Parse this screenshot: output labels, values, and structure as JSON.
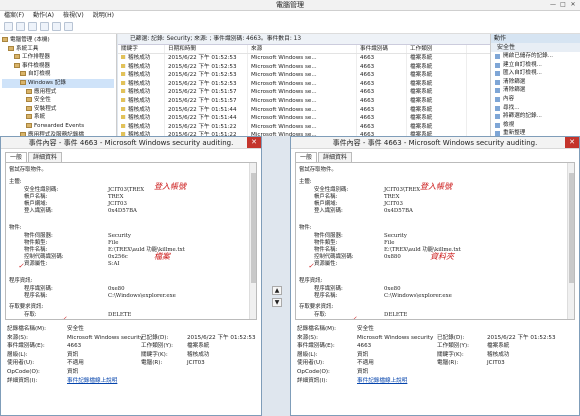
{
  "window": {
    "title": "電腦管理",
    "controls": [
      "—",
      "□",
      "✕"
    ]
  },
  "menu": [
    "檔案(F)",
    "動作(A)",
    "檢視(V)",
    "說明(H)"
  ],
  "tree": [
    {
      "label": "電腦管理 (本機)",
      "indent": 0
    },
    {
      "label": "系統工具",
      "indent": 1
    },
    {
      "label": "工作排程器",
      "indent": 2
    },
    {
      "label": "事件檢視器",
      "indent": 2
    },
    {
      "label": "自訂檢視",
      "indent": 3
    },
    {
      "label": "Windows 記錄",
      "indent": 3,
      "selected": true
    },
    {
      "label": "應用程式",
      "indent": 4
    },
    {
      "label": "安全性",
      "indent": 4
    },
    {
      "label": "安裝程式",
      "indent": 4
    },
    {
      "label": "系統",
      "indent": 4
    },
    {
      "label": "Forwarded Events",
      "indent": 4
    },
    {
      "label": "應用程式及服務記錄檔",
      "indent": 3
    }
  ],
  "list": {
    "header": "已篩選: 記錄: Security; 來源: ; 事件識別碼: 4663。事件數目: 13",
    "columns": [
      "關鍵字",
      "日期和時間",
      "來源",
      "事件識別碼",
      "工作類別"
    ],
    "rows": [
      [
        "稽核成功",
        "2015/6/22 下午 01:52:53",
        "Microsoft Windows se...",
        "4663",
        "檔案系統"
      ],
      [
        "稽核成功",
        "2015/6/22 下午 01:52:53",
        "Microsoft Windows se...",
        "4663",
        "檔案系統"
      ],
      [
        "稽核成功",
        "2015/6/22 下午 01:52:53",
        "Microsoft Windows se...",
        "4663",
        "檔案系統"
      ],
      [
        "稽核成功",
        "2015/6/22 下午 01:52:53",
        "Microsoft Windows se...",
        "4663",
        "檔案系統"
      ],
      [
        "稽核成功",
        "2015/6/22 下午 01:51:57",
        "Microsoft Windows se...",
        "4663",
        "檔案系統"
      ],
      [
        "稽核成功",
        "2015/6/22 下午 01:51:57",
        "Microsoft Windows se...",
        "4663",
        "檔案系統"
      ],
      [
        "稽核成功",
        "2015/6/22 下午 01:51:44",
        "Microsoft Windows se...",
        "4663",
        "檔案系統"
      ],
      [
        "稽核成功",
        "2015/6/22 下午 01:51:44",
        "Microsoft Windows se...",
        "4663",
        "檔案系統"
      ],
      [
        "稽核成功",
        "2015/6/22 下午 01:51:22",
        "Microsoft Windows se...",
        "4663",
        "檔案系統"
      ],
      [
        "稽核成功",
        "2015/6/22 下午 01:51:22",
        "Microsoft Windows se...",
        "4663",
        "檔案系統"
      ]
    ]
  },
  "actions": {
    "title": "動作",
    "section": "安全性",
    "items": [
      "開啟已儲存的記錄...",
      "建立自訂檢視...",
      "匯入自訂檢視...",
      "清除篩選",
      "清除篩選",
      "內容",
      "尋找...",
      "將篩選的記錄...",
      "檢視",
      "重新整理",
      "說明"
    ]
  },
  "dialogs": [
    {
      "title": "事件內容 - 事件 4663 - Microsoft Windows security auditing.",
      "tabs": [
        "一般",
        "詳細資料"
      ],
      "detail": {
        "heading": "嘗試存取物件。",
        "subject_label": "主體:",
        "fields1": [
          [
            "安全性識別碼:",
            "JCIT03\\TREX"
          ],
          [
            "帳戶名稱:",
            "TREX"
          ],
          [
            "帳戶網域:",
            "JCIT03"
          ],
          [
            "登入識別碼:",
            "0x4D57BA"
          ]
        ],
        "object_label": "物件:",
        "fields2": [
          [
            "物件伺服器:",
            "Security"
          ],
          [
            "物件類型:",
            "File"
          ],
          [
            "物件名稱:",
            "E:\\TREX\\auld 功能\\killme.txt"
          ],
          [
            "控制代碼識別碼:",
            "0x256c"
          ],
          [
            "資源屬性:",
            "S:AI"
          ]
        ],
        "process_label": "程序資訊:",
        "fields3": [
          [
            "程序識別碼:",
            "0xe80"
          ],
          [
            "程序名稱:",
            "C:\\Windows\\explorer.exe"
          ]
        ],
        "access_label": "存取要求資訊:",
        "fields4": [
          [
            "存取:",
            "DELETE"
          ]
        ],
        "notes": [
          "登入帳號",
          "檔案"
        ]
      },
      "meta": [
        [
          "記錄檔名稱(M):",
          "安全性",
          "",
          ""
        ],
        [
          "來源(S):",
          "Microsoft Windows security",
          "已記錄(D):",
          "2015/6/22 下午 01:52:53"
        ],
        [
          "事件識別碼(E):",
          "4663",
          "工作類別(Y):",
          "檔案系統"
        ],
        [
          "層級(L):",
          "資訊",
          "關鍵字(K):",
          "稽核成功"
        ],
        [
          "使用者(U):",
          "不適用",
          "電腦(R):",
          "JCIT03"
        ],
        [
          "OpCode(O):",
          "資訊",
          "",
          ""
        ],
        [
          "詳細資訊(I):",
          "事件記錄檔線上說明",
          "",
          ""
        ]
      ]
    },
    {
      "title": "事件內容 - 事件 4663 - Microsoft Windows security auditing.",
      "tabs": [
        "一般",
        "詳細資料"
      ],
      "detail": {
        "heading": "嘗試存取物件。",
        "subject_label": "主體:",
        "fields1": [
          [
            "安全性識別碼:",
            "JCIT03\\TREX"
          ],
          [
            "帳戶名稱:",
            "TREX"
          ],
          [
            "帳戶網域:",
            "JCIT03"
          ],
          [
            "登入識別碼:",
            "0x4D57BA"
          ]
        ],
        "object_label": "物件:",
        "fields2": [
          [
            "物件伺服器:",
            "Security"
          ],
          [
            "物件類型:",
            "File"
          ],
          [
            "物件名稱:",
            "E:\\TREX\\auld 功能\\killme.txt"
          ],
          [
            "控制代碼識別碼:",
            "0x880"
          ],
          [
            "資源屬性:",
            ""
          ]
        ],
        "process_label": "程序資訊:",
        "fields3": [
          [
            "程序識別碼:",
            "0xe80"
          ],
          [
            "程序名稱:",
            "C:\\Windows\\explorer.exe"
          ]
        ],
        "access_label": "存取要求資訊:",
        "fields4": [
          [
            "存取:",
            "DELETE"
          ]
        ],
        "notes": [
          "登入帳號",
          "資料夾"
        ]
      },
      "meta": [
        [
          "記錄檔名稱(M):",
          "安全性",
          "",
          ""
        ],
        [
          "來源(S):",
          "Microsoft Windows security",
          "已記錄(D):",
          "2015/6/22 下午 01:52:53"
        ],
        [
          "事件識別碼(E):",
          "4663",
          "工作類別(Y):",
          "檔案系統"
        ],
        [
          "層級(L):",
          "資訊",
          "關鍵字(K):",
          "稽核成功"
        ],
        [
          "使用者(U):",
          "不適用",
          "電腦(R):",
          "JCIT03"
        ],
        [
          "OpCode(O):",
          "資訊",
          "",
          ""
        ],
        [
          "詳細資訊(I):",
          "事件記錄檔線上說明",
          "",
          ""
        ]
      ]
    }
  ],
  "nav_arrows": [
    "▲",
    "▼"
  ],
  "colors": {
    "selection": "#cfe3f9",
    "annotation": "#cc1a1a",
    "link": "#0645ad",
    "close": "#c4342b"
  }
}
